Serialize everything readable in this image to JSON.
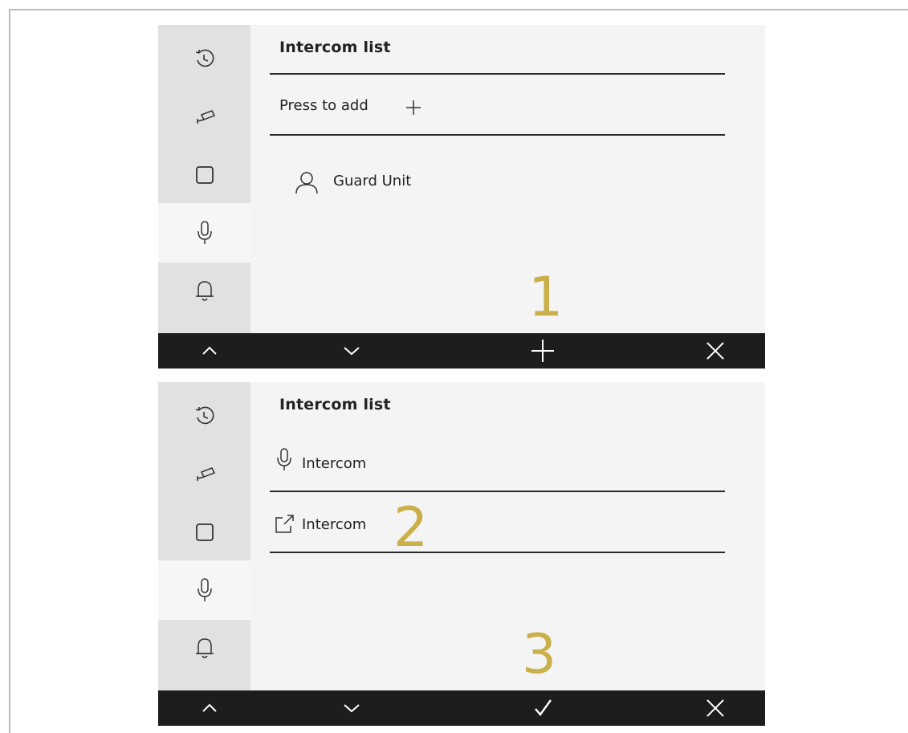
{
  "panel1": {
    "title": "Intercom list",
    "add_label": "Press to add",
    "contact": "Guard Unit",
    "step": "1"
  },
  "panel2": {
    "title": "Intercom list",
    "item1_label": "Intercom",
    "item2_label": "Intercom",
    "step2": "2",
    "step3": "3"
  },
  "sidebar_icons": [
    "history-icon",
    "camera-icon",
    "square-icon",
    "microphone-icon",
    "bell-icon"
  ],
  "bottombar_icons_panel1": [
    "chevron-up-icon",
    "chevron-down-icon",
    "plus-icon",
    "close-icon"
  ],
  "bottombar_icons_panel2": [
    "chevron-up-icon",
    "chevron-down-icon",
    "checkmark-icon",
    "close-icon"
  ],
  "colors": {
    "annotation": "#c9b04a",
    "bottombar": "#1d1d1d",
    "sidebar": "#e1e1e1",
    "panel": "#f4f4f4"
  }
}
